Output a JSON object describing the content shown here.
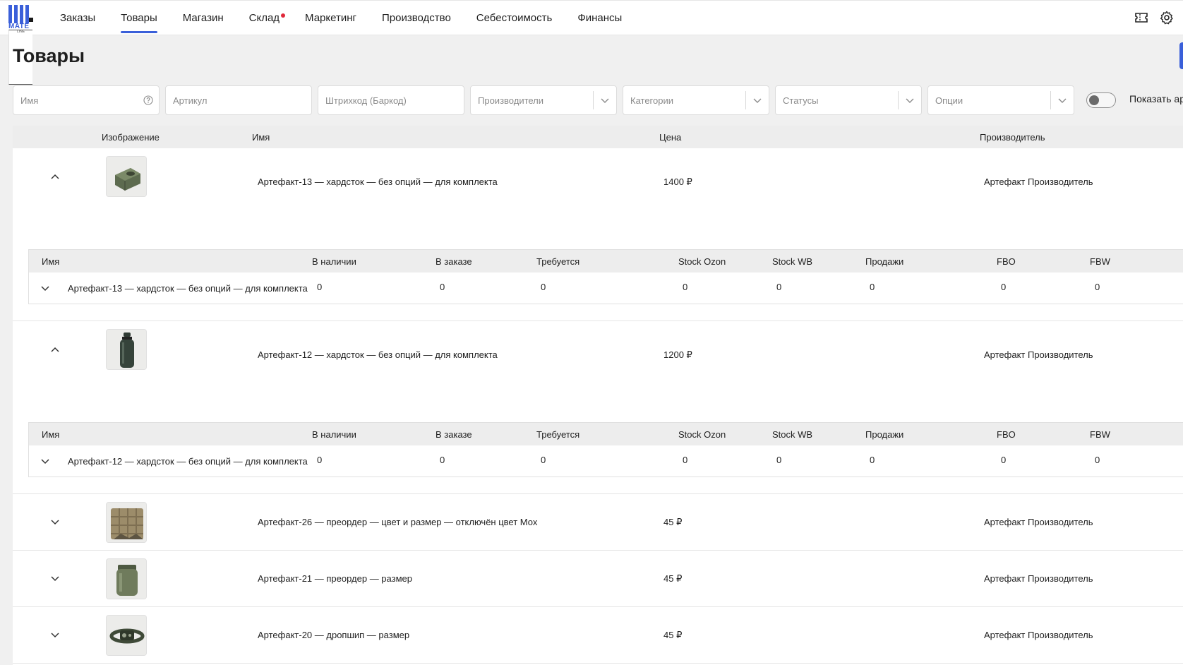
{
  "app": {
    "logo_text": "MATE",
    "logo_sub": "LINE"
  },
  "nav": {
    "items": [
      {
        "label": "Заказы",
        "active": false,
        "dot": false
      },
      {
        "label": "Товары",
        "active": true,
        "dot": false
      },
      {
        "label": "Магазин",
        "active": false,
        "dot": false
      },
      {
        "label": "Склад",
        "active": false,
        "dot": true
      },
      {
        "label": "Маркетинг",
        "active": false,
        "dot": false
      },
      {
        "label": "Производство",
        "active": false,
        "dot": false
      },
      {
        "label": "Себестоимость",
        "active": false,
        "dot": false
      },
      {
        "label": "Финансы",
        "active": false,
        "dot": false
      }
    ],
    "right_icons": [
      "ticket-icon",
      "gear-icon"
    ]
  },
  "page": {
    "title": "Товары"
  },
  "filters": {
    "name_placeholder": "Имя",
    "article_placeholder": "Артикул",
    "barcode_placeholder": "Штрихкод (Баркод)",
    "manufacturers_placeholder": "Производители",
    "categories_placeholder": "Категории",
    "statuses_placeholder": "Статусы",
    "options_placeholder": "Опции",
    "toggle_label": "Показать ар",
    "toggle_on": false
  },
  "table": {
    "headers": {
      "image": "Изображение",
      "name": "Имя",
      "price": "Цена",
      "manufacturer": "Производитель"
    },
    "sub_headers": {
      "name": "Имя",
      "in_stock": "В наличии",
      "on_order": "В заказе",
      "required": "Требуется",
      "stock_ozon": "Stock Ozon",
      "stock_wb": "Stock WB",
      "sales": "Продажи",
      "fbo": "FBO",
      "fbw": "FBW"
    },
    "rows": [
      {
        "name": "Артефакт-13 — хардсток — без опций — для комплекта",
        "price": "1400 ₽",
        "manufacturer": "Артефакт Производитель",
        "expanded": true,
        "image_icon": "tin-can-icon",
        "variant": {
          "name": "Артефакт-13 — хардсток — без опций — для комплекта",
          "in_stock": "0",
          "on_order": "0",
          "required": "0",
          "stock_ozon": "0",
          "stock_wb": "0",
          "sales": "0",
          "fbo": "0",
          "fbw": "0"
        }
      },
      {
        "name": "Артефакт-12 — хардсток — без опций — для комплекта",
        "price": "1200 ₽",
        "manufacturer": "Артефакт Производитель",
        "expanded": true,
        "image_icon": "bottle-icon",
        "variant": {
          "name": "Артефакт-12 — хардсток — без опций — для комплекта",
          "in_stock": "0",
          "on_order": "0",
          "required": "0",
          "stock_ozon": "0",
          "stock_wb": "0",
          "sales": "0",
          "fbo": "0",
          "fbw": "0"
        }
      },
      {
        "name": "Артефакт-26 — преордер — цвет и размер — отключён цвет Мох",
        "price": "45 ₽",
        "manufacturer": "Артефакт Производитель",
        "expanded": false,
        "image_icon": "folded-cloth-icon"
      },
      {
        "name": "Артефакт-21 — преордер — размер",
        "price": "45 ₽",
        "manufacturer": "Артефакт Производитель",
        "expanded": false,
        "image_icon": "dry-bag-icon"
      },
      {
        "name": "Артефакт-20 — дропшип — размер",
        "price": "45 ₽",
        "manufacturer": "Артефакт Производитель",
        "expanded": false,
        "image_icon": "headlamp-icon"
      }
    ]
  },
  "colors": {
    "accent": "#3a5fd9",
    "alert_dot": "#e0283a",
    "header_bg": "#ededed",
    "page_bg": "#f0f0f0"
  }
}
